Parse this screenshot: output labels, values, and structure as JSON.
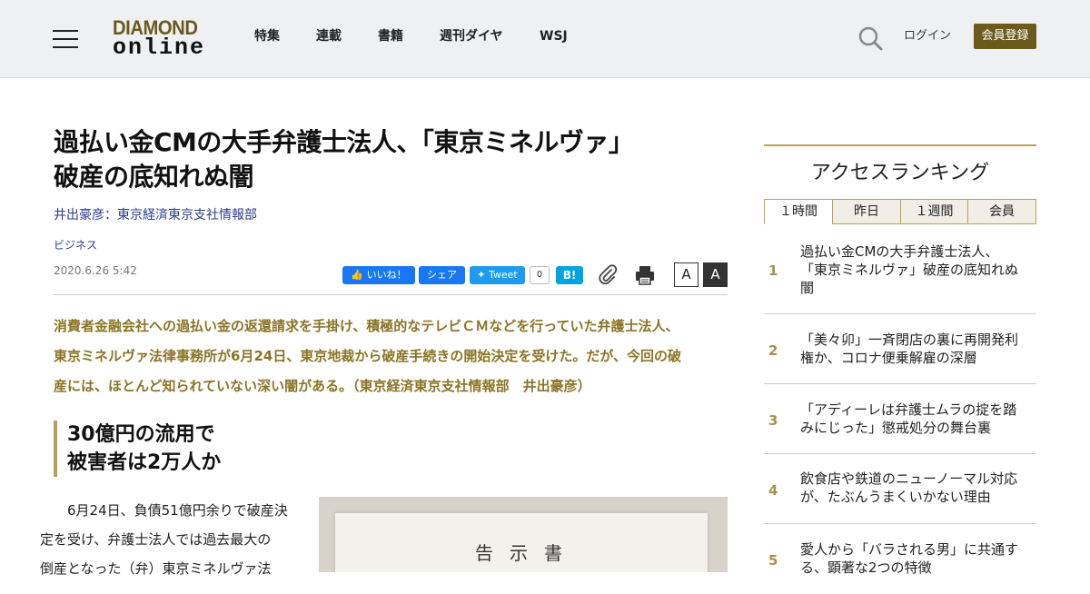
{
  "header": {
    "logo_line1": "DIAMOND",
    "logo_line2": "online",
    "nav": [
      "特集",
      "連載",
      "書籍",
      "週刊ダイヤ",
      "WSJ"
    ],
    "login": "ログイン",
    "register": "会員登録"
  },
  "article": {
    "title_line1": "過払い金CMの大手弁護士法人、「東京ミネルヴァ」",
    "title_line2": "破産の底知れぬ闇",
    "author": "井出豪彦：東京経済東京支社情報部",
    "category": "ビジネス",
    "date": "2020.6.26 5:42",
    "share": {
      "like": "いいね！",
      "share": "シェア",
      "tweet": "Tweet",
      "tweet_count": "0",
      "hatena": "B!"
    },
    "font_small": "A",
    "font_large": "A",
    "lead_line1": "消費者金融会社への過払い金の返還請求を手掛け、積極的なテレビＣＭなどを行っていた弁護士法人、",
    "lead_line2": "東京ミネルヴァ法律事務所が6月24日、東京地裁から破産手続きの開始決定を受けた。だが、今回の破",
    "lead_line3": "産には、ほとんど知られていない深い闇がある。（東京経済東京支社情報部　井出豪彦）",
    "subhead_line1": "30億円の流用で",
    "subhead_line2": "被害者は2万人か",
    "body_line1": "6月24日、負債51億円余りで破産決",
    "body_line2": "定を受け、弁護士法人では過去最大の",
    "body_line3": "倒産となった（弁）東京ミネルヴァ法",
    "photo_text": "告示書"
  },
  "sidebar": {
    "title": "アクセスランキング",
    "tabs": [
      "１時間",
      "昨日",
      "１週間",
      "会員"
    ],
    "active_tab": "１時間",
    "ranking": [
      {
        "num": "1",
        "line1": "過払い金CMの大手弁護士法人、",
        "line2": "「東京ミネルヴァ」破産の底知れぬ",
        "line3": "闇"
      },
      {
        "num": "2",
        "line1": "「美々卯」一斉閉店の裏に再開発利",
        "line2": "権か、コロナ便乗解雇の深層",
        "line3": ""
      },
      {
        "num": "3",
        "line1": "「アディーレは弁護士ムラの掟を踏",
        "line2": "みにじった」懲戒処分の舞台裏",
        "line3": ""
      },
      {
        "num": "4",
        "line1": "飲食店や鉄道のニューノーマル対応",
        "line2": "が、たぶんうまくいかない理由",
        "line3": ""
      },
      {
        "num": "5",
        "line1": "愛人から「バラされる男」に共通す",
        "line2": "る、顕著な2つの特徴",
        "line3": ""
      }
    ]
  }
}
